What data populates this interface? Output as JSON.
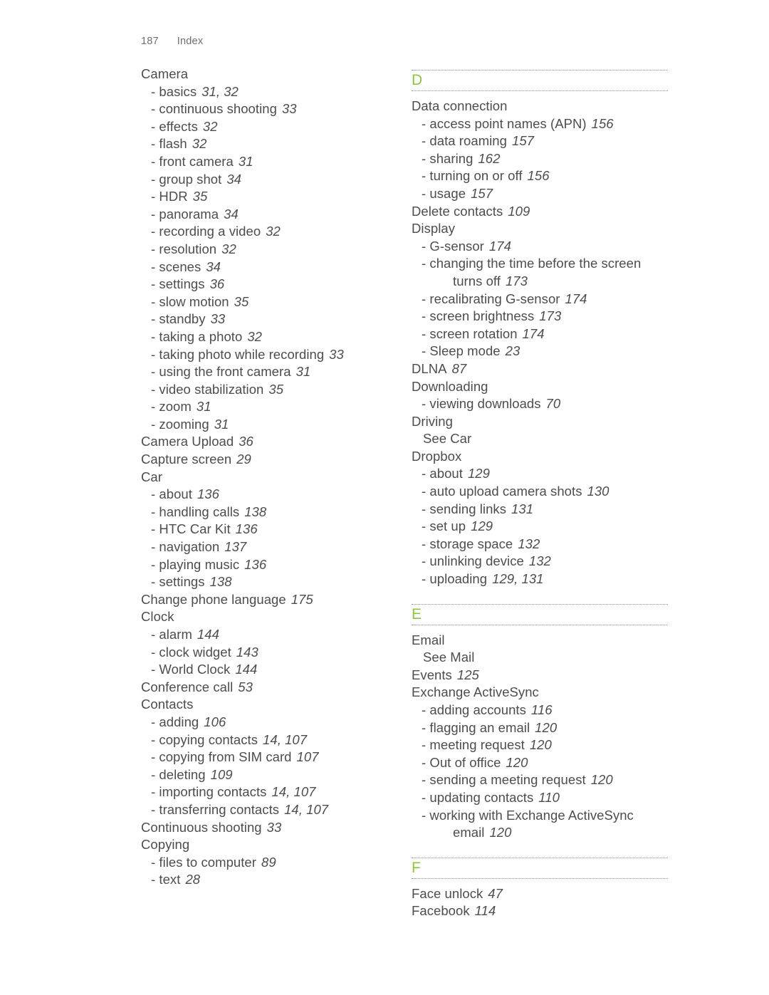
{
  "header": {
    "folio": "187",
    "title": "Index"
  },
  "theme": {
    "accent_green": "#8cc63e",
    "text_gray": "#4d4d4d",
    "header_gray": "#6e6e6e",
    "rule_gray": "#8a8a8a"
  },
  "left_column": {
    "entries": [
      {
        "level": 0,
        "label": "Camera",
        "pages": ""
      },
      {
        "level": 1,
        "label": "basics",
        "pages": "31, 32"
      },
      {
        "level": 1,
        "label": "continuous shooting",
        "pages": "33"
      },
      {
        "level": 1,
        "label": "effects",
        "pages": "32"
      },
      {
        "level": 1,
        "label": "flash",
        "pages": "32"
      },
      {
        "level": 1,
        "label": "front camera",
        "pages": "31"
      },
      {
        "level": 1,
        "label": "group shot",
        "pages": "34"
      },
      {
        "level": 1,
        "label": "HDR",
        "pages": "35"
      },
      {
        "level": 1,
        "label": "panorama",
        "pages": "34"
      },
      {
        "level": 1,
        "label": "recording a video",
        "pages": "32"
      },
      {
        "level": 1,
        "label": "resolution",
        "pages": "32"
      },
      {
        "level": 1,
        "label": "scenes",
        "pages": "34"
      },
      {
        "level": 1,
        "label": "settings",
        "pages": "36"
      },
      {
        "level": 1,
        "label": "slow motion",
        "pages": "35"
      },
      {
        "level": 1,
        "label": "standby",
        "pages": "33"
      },
      {
        "level": 1,
        "label": "taking a photo",
        "pages": "32"
      },
      {
        "level": 1,
        "label": "taking photo while recording",
        "pages": "33"
      },
      {
        "level": 1,
        "label": "using the front camera",
        "pages": "31"
      },
      {
        "level": 1,
        "label": "video stabilization",
        "pages": "35"
      },
      {
        "level": 1,
        "label": "zoom",
        "pages": "31"
      },
      {
        "level": 1,
        "label": "zooming",
        "pages": "31"
      },
      {
        "level": 0,
        "label": "Camera Upload",
        "pages": "36"
      },
      {
        "level": 0,
        "label": "Capture screen",
        "pages": "29"
      },
      {
        "level": 0,
        "label": "Car",
        "pages": ""
      },
      {
        "level": 1,
        "label": "about",
        "pages": "136"
      },
      {
        "level": 1,
        "label": "handling calls",
        "pages": "138"
      },
      {
        "level": 1,
        "label": "HTC Car Kit",
        "pages": "136"
      },
      {
        "level": 1,
        "label": "navigation",
        "pages": "137"
      },
      {
        "level": 1,
        "label": "playing music",
        "pages": "136"
      },
      {
        "level": 1,
        "label": "settings",
        "pages": "138"
      },
      {
        "level": 0,
        "label": "Change phone language",
        "pages": "175"
      },
      {
        "level": 0,
        "label": "Clock",
        "pages": ""
      },
      {
        "level": 1,
        "label": "alarm",
        "pages": "144"
      },
      {
        "level": 1,
        "label": "clock widget",
        "pages": "143"
      },
      {
        "level": 1,
        "label": "World Clock",
        "pages": "144"
      },
      {
        "level": 0,
        "label": "Conference call",
        "pages": "53"
      },
      {
        "level": 0,
        "label": "Contacts",
        "pages": ""
      },
      {
        "level": 1,
        "label": "adding",
        "pages": "106"
      },
      {
        "level": 1,
        "label": "copying contacts",
        "pages": "14, 107"
      },
      {
        "level": 1,
        "label": "copying from SIM card",
        "pages": "107"
      },
      {
        "level": 1,
        "label": "deleting",
        "pages": "109"
      },
      {
        "level": 1,
        "label": "importing contacts",
        "pages": "14, 107"
      },
      {
        "level": 1,
        "label": "transferring contacts",
        "pages": "14, 107"
      },
      {
        "level": 0,
        "label": "Continuous shooting",
        "pages": "33"
      },
      {
        "level": 0,
        "label": "Copying",
        "pages": ""
      },
      {
        "level": 1,
        "label": "files to computer",
        "pages": "89"
      },
      {
        "level": 1,
        "label": "text",
        "pages": "28"
      }
    ]
  },
  "right_column": {
    "sections": [
      {
        "letter": "D",
        "entries": [
          {
            "level": 0,
            "label": "Data connection",
            "pages": ""
          },
          {
            "level": 1,
            "label": "access point names (APN)",
            "pages": "156"
          },
          {
            "level": 1,
            "label": "data roaming",
            "pages": "157"
          },
          {
            "level": 1,
            "label": "sharing",
            "pages": "162"
          },
          {
            "level": 1,
            "label": "turning on or off",
            "pages": "156"
          },
          {
            "level": 1,
            "label": "usage",
            "pages": "157"
          },
          {
            "level": 0,
            "label": "Delete contacts",
            "pages": "109"
          },
          {
            "level": 0,
            "label": "Display",
            "pages": ""
          },
          {
            "level": 1,
            "label": "G-sensor",
            "pages": "174"
          },
          {
            "level": 1,
            "label": "changing the time before the screen",
            "pages": ""
          },
          {
            "level": 2,
            "label": "turns off",
            "pages": "173"
          },
          {
            "level": 1,
            "label": "recalibrating G-sensor",
            "pages": "174"
          },
          {
            "level": 1,
            "label": "screen brightness",
            "pages": "173"
          },
          {
            "level": 1,
            "label": "screen rotation",
            "pages": "174"
          },
          {
            "level": 1,
            "label": "Sleep mode",
            "pages": "23"
          },
          {
            "level": 0,
            "label": "DLNA",
            "pages": "87"
          },
          {
            "level": 0,
            "label": "Downloading",
            "pages": ""
          },
          {
            "level": 1,
            "label": "viewing downloads",
            "pages": "70"
          },
          {
            "level": 0,
            "label": "Driving",
            "pages": ""
          },
          {
            "level": 3,
            "label": "See Car",
            "pages": ""
          },
          {
            "level": 0,
            "label": "Dropbox",
            "pages": ""
          },
          {
            "level": 1,
            "label": "about",
            "pages": "129"
          },
          {
            "level": 1,
            "label": "auto upload camera shots",
            "pages": "130"
          },
          {
            "level": 1,
            "label": "sending links",
            "pages": "131"
          },
          {
            "level": 1,
            "label": "set up",
            "pages": "129"
          },
          {
            "level": 1,
            "label": "storage space",
            "pages": "132"
          },
          {
            "level": 1,
            "label": "unlinking device",
            "pages": "132"
          },
          {
            "level": 1,
            "label": "uploading",
            "pages": "129, 131"
          }
        ]
      },
      {
        "letter": "E",
        "entries": [
          {
            "level": 0,
            "label": "Email",
            "pages": ""
          },
          {
            "level": 3,
            "label": "See Mail",
            "pages": ""
          },
          {
            "level": 0,
            "label": "Events",
            "pages": "125"
          },
          {
            "level": 0,
            "label": "Exchange ActiveSync",
            "pages": ""
          },
          {
            "level": 1,
            "label": "adding accounts",
            "pages": "116"
          },
          {
            "level": 1,
            "label": "flagging an email",
            "pages": "120"
          },
          {
            "level": 1,
            "label": "meeting request",
            "pages": "120"
          },
          {
            "level": 1,
            "label": "Out of office",
            "pages": "120"
          },
          {
            "level": 1,
            "label": "sending a meeting request",
            "pages": "120"
          },
          {
            "level": 1,
            "label": "updating contacts",
            "pages": "110"
          },
          {
            "level": 1,
            "label": "working with Exchange ActiveSync",
            "pages": ""
          },
          {
            "level": 2,
            "label": "email",
            "pages": "120"
          }
        ]
      },
      {
        "letter": "F",
        "entries": [
          {
            "level": 0,
            "label": "Face unlock",
            "pages": "47"
          },
          {
            "level": 0,
            "label": "Facebook",
            "pages": "114"
          }
        ]
      }
    ]
  }
}
